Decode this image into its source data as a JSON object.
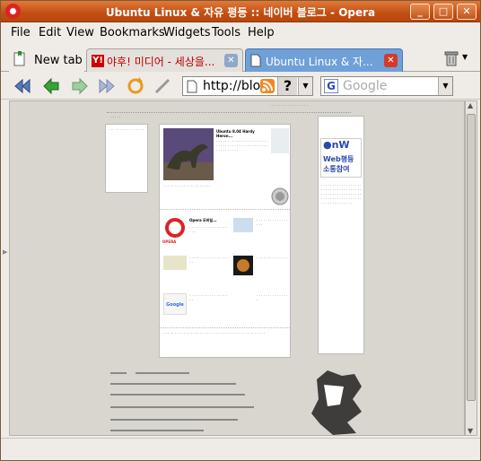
{
  "window": {
    "title": "Ubuntu Linux & 자유 평등 :: 네이버 블로그 - Opera",
    "controls": [
      "_",
      "□",
      "✕"
    ]
  },
  "menu": [
    "File",
    "Edit",
    "View",
    "Bookmarks",
    "Widgets",
    "Tools",
    "Help"
  ],
  "tabs": [
    {
      "label": "New tab",
      "icon": "new-tab-icon"
    },
    {
      "label": "야후! 미디어 - 세상을...",
      "icon": "yahoo-icon"
    },
    {
      "label": "Ubuntu Linux & 자...",
      "icon": "page-icon",
      "active": true
    }
  ],
  "addressbar": {
    "value": "http://blo"
  },
  "search": {
    "placeholder": "Google",
    "engine": "G"
  },
  "page": {
    "post1_title": "Ubuntu 8.04 Hardy Heron...",
    "post2_title": "Opera 모바일...",
    "badge_line1": "Web평등",
    "badge_line2": "소통참여",
    "opera_label": "OPERA",
    "google_label": "Google"
  },
  "colors": {
    "title_bar": "#c2561c",
    "active_tab": "#6fa0d8",
    "badge_blue": "#2a4aa8",
    "badge_red": "#d83a2a"
  }
}
